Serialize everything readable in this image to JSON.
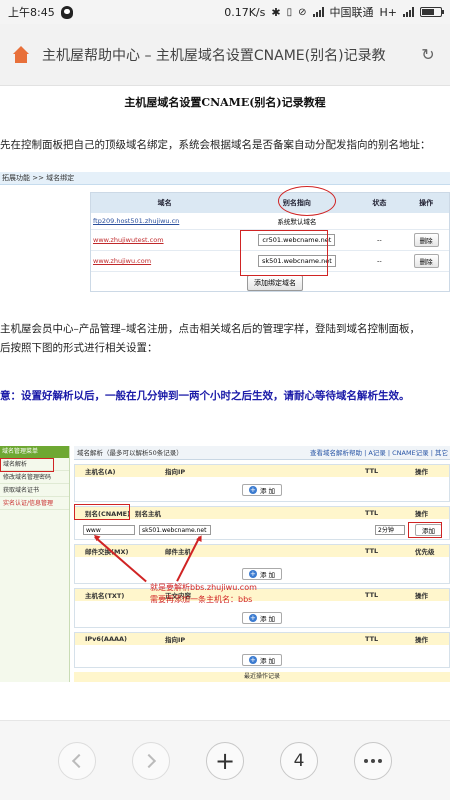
{
  "status": {
    "time": "上午8:45",
    "speed": "0.17K/s",
    "carrier": "中国联通",
    "network": "H+"
  },
  "browser": {
    "title": "主机屋帮助中心 – 主机屋域名设置CNAME(别名)记录教"
  },
  "article": {
    "title": "主机屋域名设置CNAME(别名)记录教程",
    "para1": "先在控制面板把自己的顶级域名绑定，系统会根据域名是否备案自动分配发指向的别名地址：",
    "para2_line1": "主机屋会员中心–产品管理–域名注册，点击相关域名后的管理字样，登陆到域名控制面板，",
    "para2_line2": "后按照下图的形式进行相关设置：",
    "warning": "意：设置好解析以后，一般在几分钟到一两个小时之后生效，请耐心等待域名解析生效。"
  },
  "shot1": {
    "breadcrumb": "拓展功能 >> 域名绑定",
    "headers": [
      "域名",
      "别名指向",
      "状态",
      "操作"
    ],
    "rows": [
      {
        "domain": "ftp209.host501.zhujiwu.cn",
        "cname": "系统默认域名",
        "status": "",
        "action": ""
      },
      {
        "domain": "www.zhujiwutest.com",
        "cname": "cr501.webcname.net",
        "status": "--",
        "action": "删除"
      },
      {
        "domain": "www.zhujiwu.com",
        "cname": "sk501.webcname.net",
        "status": "--",
        "action": "删除"
      }
    ],
    "add_button": "添加绑定域名"
  },
  "shot2": {
    "side_title": "域名管理菜单",
    "side_items": [
      "域名解析",
      "修改域名管理密码",
      "获取域名证书",
      "实名认证/信息管理"
    ],
    "top_left": "域名解析（最多可以解析50条记录）",
    "top_right": "查看域名解析帮助 | A记录 | CNAME记录 | 其它",
    "sec_a": {
      "h1": "主机名(A)",
      "h2": "指向IP",
      "h3": "TTL",
      "h4": "操作",
      "btn": "添 加"
    },
    "sec_cname": {
      "h1": "别名(CNAME)",
      "h2": "别名主机",
      "h3": "TTL",
      "h4": "操作",
      "host": "www",
      "target": "sk501.webcname.net",
      "ttl": "2分钟",
      "btn": "添加"
    },
    "sec_mx": {
      "h1": "邮件交换(MX)",
      "h2": "邮件主机",
      "h3": "TTL",
      "h4": "优先级",
      "btn": "添 加"
    },
    "note_line1": "就是要解析bbs.zhujiwu.com",
    "note_line2": "需要再添加一条主机名：bbs",
    "sec_txt": {
      "h1": "主机名(TXT)",
      "h2": "正文内容",
      "h3": "TTL",
      "h4": "操作",
      "btn": "添 加"
    },
    "sec_aaaa": {
      "h1": "IPv6(AAAA)",
      "h2": "指向IP",
      "h3": "TTL",
      "h4": "操作",
      "btn": "添 加"
    },
    "footer": "最近操作记录"
  },
  "nav": {
    "tab_count": "4"
  }
}
